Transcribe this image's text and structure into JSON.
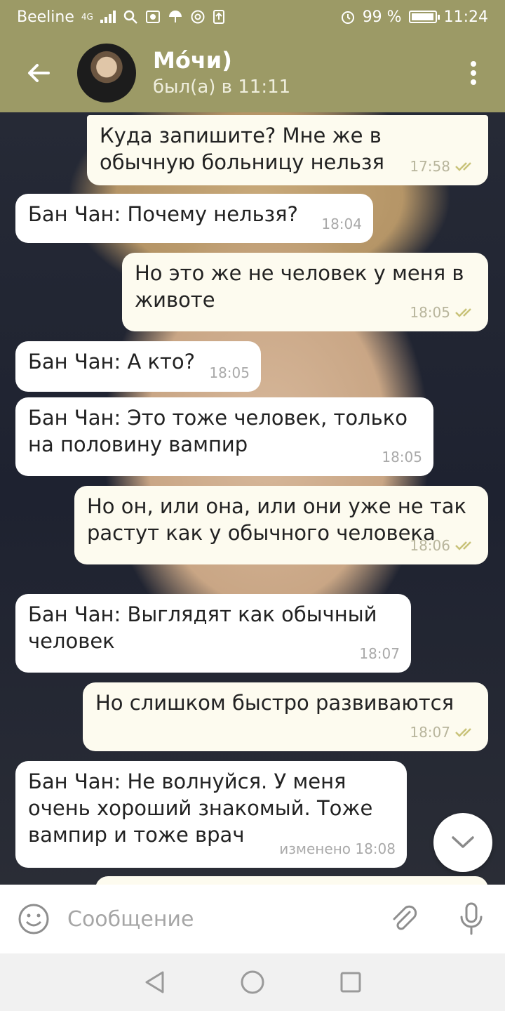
{
  "status_bar": {
    "carrier": "Beeline",
    "network": "4G",
    "battery": "99 %",
    "battery_level": 0.99,
    "time": "11:24"
  },
  "header": {
    "title": "Мо́чи)",
    "subtitle": "был(а) в 11:11"
  },
  "messages": [
    {
      "dir": "out",
      "text": "Куда запишите? Мне же в обычную больницу нельзя",
      "time": "17:58",
      "read": true
    },
    {
      "dir": "in",
      "text": "Бан Чан: Почему нельзя?",
      "time": "18:04"
    },
    {
      "dir": "out",
      "text": "Но это же не человек у меня в животе",
      "time": "18:05",
      "read": true
    },
    {
      "dir": "in",
      "text": "Бан Чан: А кто?",
      "time": "18:05"
    },
    {
      "dir": "in",
      "text": "Бан Чан: Это тоже человек, только на половину вампир",
      "time": "18:05"
    },
    {
      "dir": "out",
      "text": "Но он, или она, или они уже не так растут как у обычного человека",
      "time": "18:06",
      "read": true
    },
    {
      "dir": "in",
      "text": "Бан Чан: Выглядят как обычный человек",
      "time": "18:07"
    },
    {
      "dir": "out",
      "text": "Но слишком быстро развиваются",
      "time": "18:07",
      "read": true
    },
    {
      "dir": "in",
      "text": "Бан Чан: Не волнуйся. У меня очень хороший знакомый. Тоже вампир и тоже врач",
      "time": "изменено 18:08"
    }
  ],
  "input": {
    "placeholder": "Сообщение"
  },
  "colors": {
    "header": "#9c9a66",
    "bubble_in": "#ffffff",
    "bubble_out": "#fdfbef",
    "read_checks": "#c9c37a"
  },
  "icons": [
    "back-arrow-icon",
    "more-vert-icon",
    "emoji-icon",
    "attach-icon",
    "mic-icon",
    "chevron-down-icon",
    "nav-back-icon",
    "nav-home-icon",
    "nav-recents-icon"
  ]
}
